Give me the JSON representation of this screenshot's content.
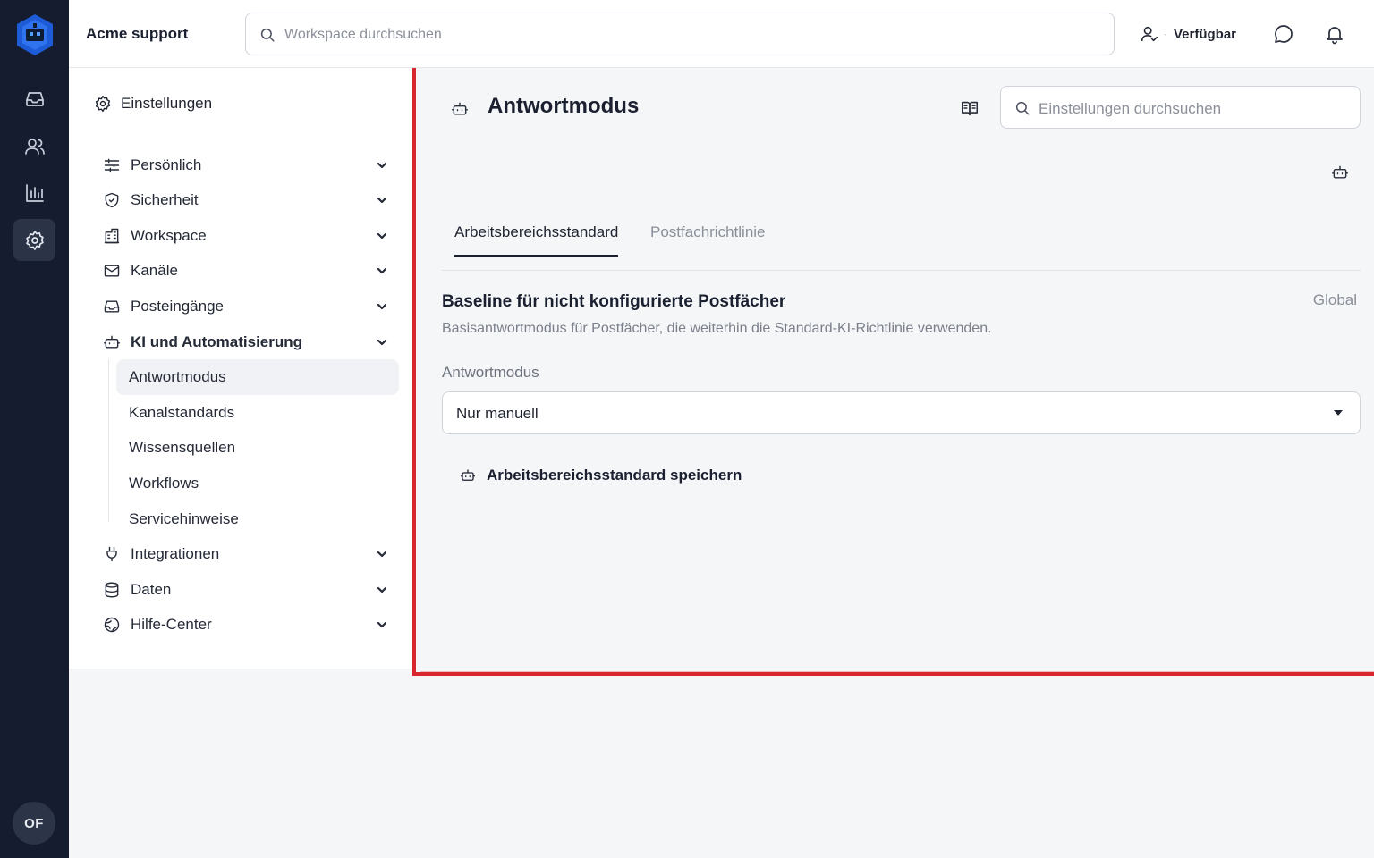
{
  "colors": {
    "rail_bg": "#151c2f",
    "accent_logo": "#1e5bd6",
    "highlight_border": "#d7262e"
  },
  "topbar": {
    "workspace_name": "Acme support",
    "search_placeholder": "Workspace durchsuchen",
    "status_dot": "·",
    "status_label": "Verfügbar",
    "icons": [
      "user-status-icon",
      "chat-icon",
      "bell-icon"
    ]
  },
  "rail": {
    "items": [
      "inbox-icon",
      "users-icon",
      "reports-icon",
      "settings-icon"
    ],
    "avatar_initials": "OF"
  },
  "nav": {
    "title": "Einstellungen",
    "items": [
      {
        "label": "Persönlich",
        "icon": "sliders-icon"
      },
      {
        "label": "Sicherheit",
        "icon": "shield-icon"
      },
      {
        "label": "Workspace",
        "icon": "building-icon"
      },
      {
        "label": "Kanäle",
        "icon": "mail-icon"
      },
      {
        "label": "Posteingänge",
        "icon": "inbox-icon"
      },
      {
        "label": "KI und Automatisierung",
        "icon": "bot-icon"
      },
      {
        "label": "Integrationen",
        "icon": "plug-icon"
      },
      {
        "label": "Daten",
        "icon": "database-icon"
      },
      {
        "label": "Hilfe-Center",
        "icon": "globe-icon"
      }
    ],
    "sub_items": [
      "Antwortmodus",
      "Kanalstandards",
      "Wissensquellen",
      "Workflows",
      "Servicehinweise"
    ]
  },
  "main": {
    "title": "Antwortmodus",
    "search_placeholder": "Einstellungen durchsuchen",
    "tabs": [
      "Arbeitsbereichsstandard",
      "Postfachrichtlinie"
    ],
    "section": {
      "title": "Baseline für nicht konfigurierte Postfächer",
      "scope": "Global",
      "description": "Basisantwortmodus für Postfächer, die weiterhin die Standard-KI-Richtlinie verwenden."
    },
    "field_label": "Antwortmodus",
    "select_value": "Nur manuell",
    "save_label": "Arbeitsbereichsstandard speichern"
  }
}
